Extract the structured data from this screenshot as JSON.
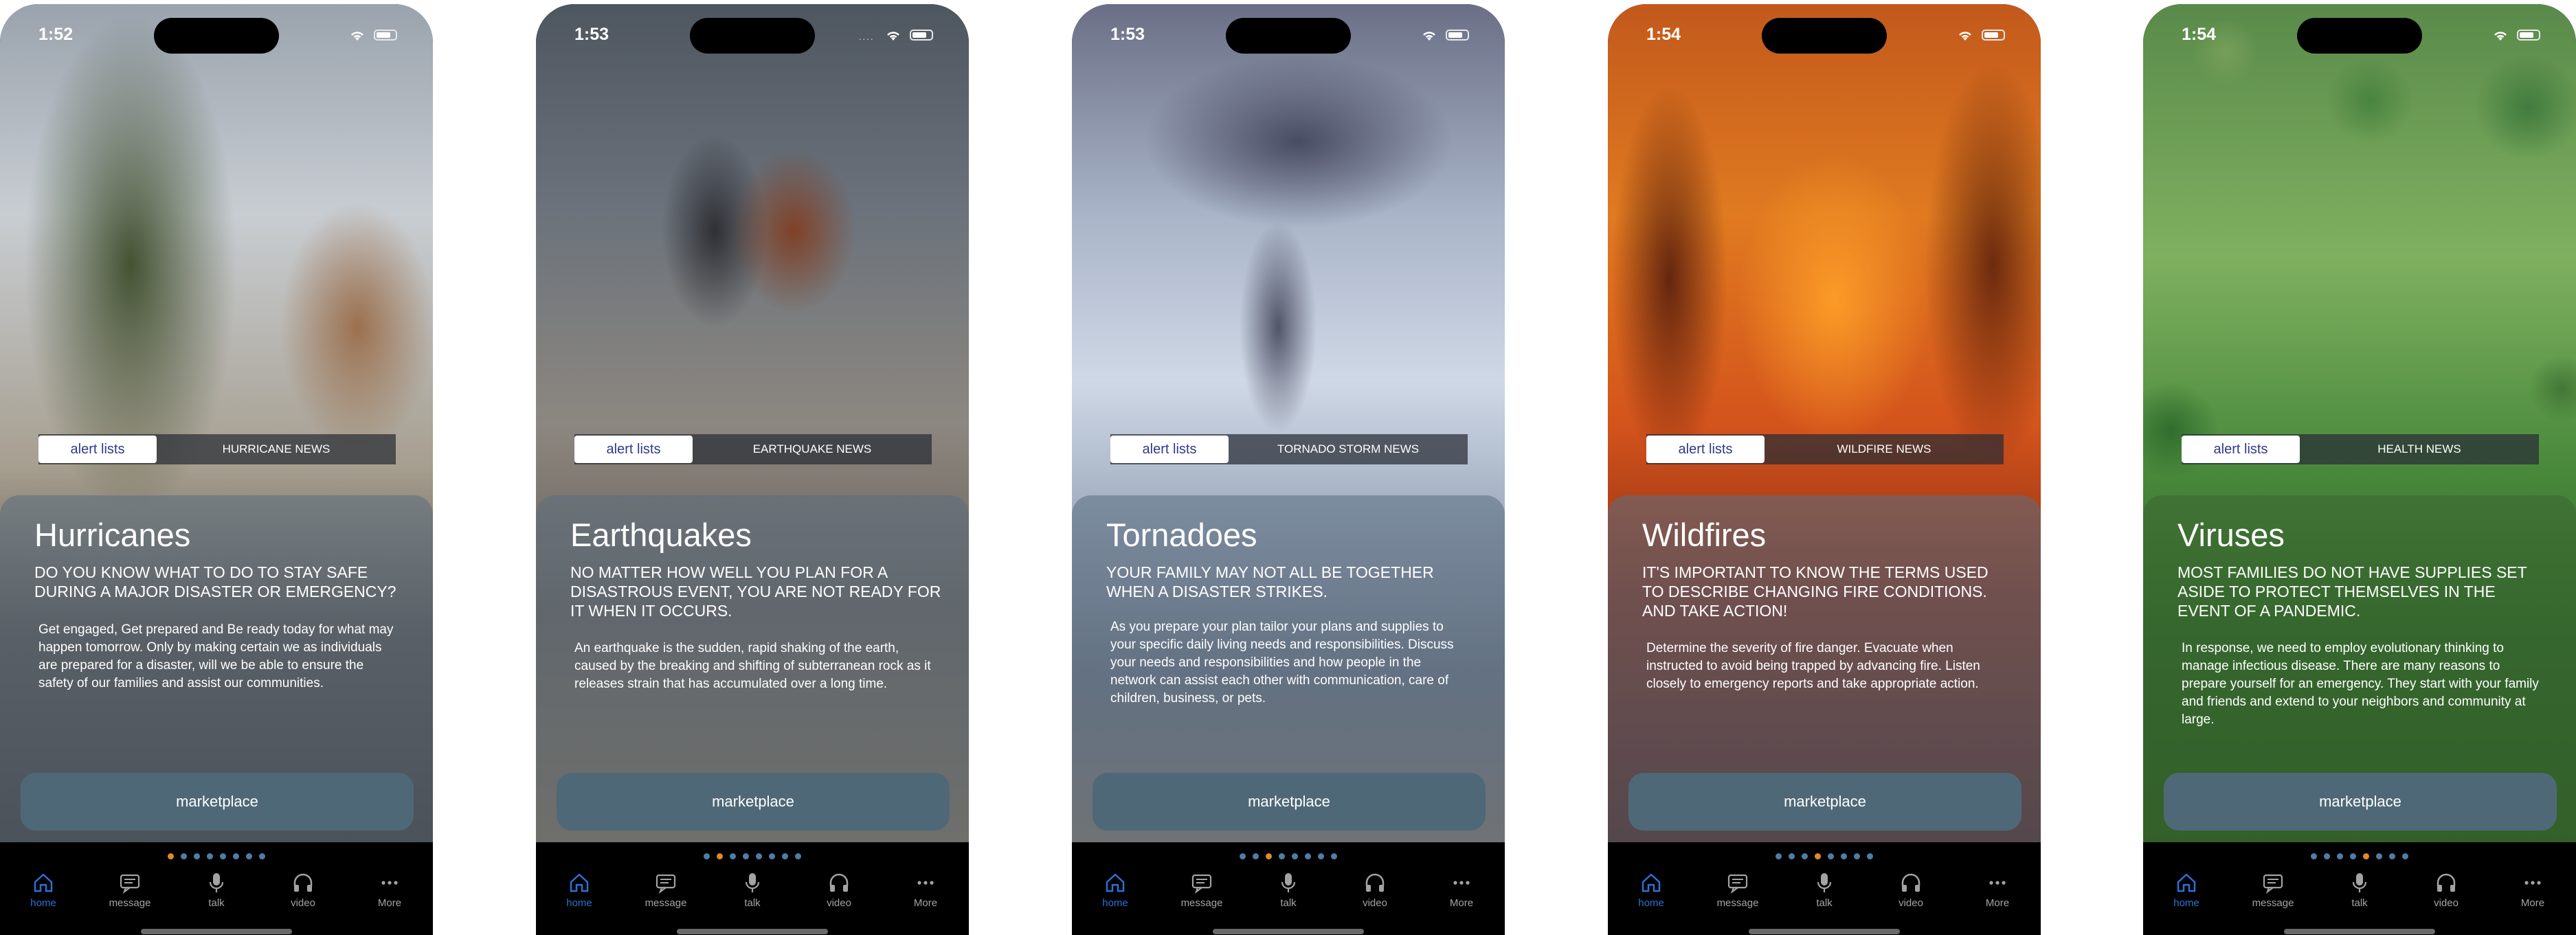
{
  "screens": [
    {
      "time": "1:52",
      "segment": {
        "alert": "alert lists",
        "news": "HURRICANE NEWS"
      },
      "title": "Hurricanes",
      "subtitle": "DO YOU KNOW WHAT TO DO TO STAY SAFE DURING A MAJOR DISASTER OR EMERGENCY?",
      "body": "Get engaged, Get prepared and Be ready today for what may happen tomorrow. Only by making certain we as individuals are prepared for a disaster, will we be able to ensure the safety of our families and assist our communities.",
      "button": "marketplace",
      "active_dot": 1
    },
    {
      "time": "1:53",
      "segment": {
        "alert": "alert lists",
        "news": "EARTHQUAKE NEWS"
      },
      "title": "Earthquakes",
      "subtitle": "NO MATTER HOW WELL YOU PLAN FOR A DISASTROUS EVENT, YOU ARE NOT READY FOR IT WHEN IT OCCURS.",
      "body": "An earthquake is the sudden, rapid shaking of the earth, caused by the breaking and shifting of subterranean rock as it releases strain that has accumulated over a long time.",
      "button": "marketplace",
      "active_dot": 2
    },
    {
      "time": "1:53",
      "segment": {
        "alert": "alert lists",
        "news": "TORNADO STORM NEWS"
      },
      "title": "Tornadoes",
      "subtitle": "YOUR FAMILY MAY NOT ALL BE TOGETHER WHEN A DISASTER STRIKES.",
      "body": "As you prepare your plan tailor your plans and supplies to your specific daily living needs and responsibilities. Discuss your needs and responsibilities and how people in the network can assist each other with communication, care of children, business, or pets.",
      "button": "marketplace",
      "active_dot": 3
    },
    {
      "time": "1:54",
      "segment": {
        "alert": "alert lists",
        "news": "WILDFIRE NEWS"
      },
      "title": "Wildfires",
      "subtitle": "IT'S IMPORTANT TO KNOW THE TERMS USED TO DESCRIBE CHANGING FIRE CONDITIONS. AND TAKE ACTION!",
      "body": "Determine the severity of fire danger. Evacuate when instructed to avoid being trapped by advancing fire. Listen closely to emergency reports and take appropriate action.",
      "button": "marketplace",
      "active_dot": 4
    },
    {
      "time": "1:54",
      "segment": {
        "alert": "alert lists",
        "news": "HEALTH NEWS"
      },
      "title": "Viruses",
      "subtitle": "MOST FAMILIES DO NOT HAVE SUPPLIES SET ASIDE TO PROTECT THEMSELVES IN THE EVENT OF A PANDEMIC.",
      "body": "In response, we need to employ evolutionary thinking to manage infectious disease. There are many reasons to prepare yourself for an emergency. They start with your family and friends and extend to your neighbors and community at large.",
      "button": "marketplace",
      "active_dot": 5
    }
  ],
  "page_dots_count": 8,
  "nav": [
    {
      "label": "home",
      "icon": "home-icon"
    },
    {
      "label": "message",
      "icon": "message-icon"
    },
    {
      "label": "talk",
      "icon": "microphone-icon"
    },
    {
      "label": "video",
      "icon": "headphones-icon"
    },
    {
      "label": "More",
      "icon": "more-icon"
    }
  ],
  "colors": {
    "accent_blue": "#2f6fd6",
    "marketplace_button": "#4f6877",
    "active_dot": "#e08a2a",
    "inactive_dot": "#4c7ea8"
  }
}
